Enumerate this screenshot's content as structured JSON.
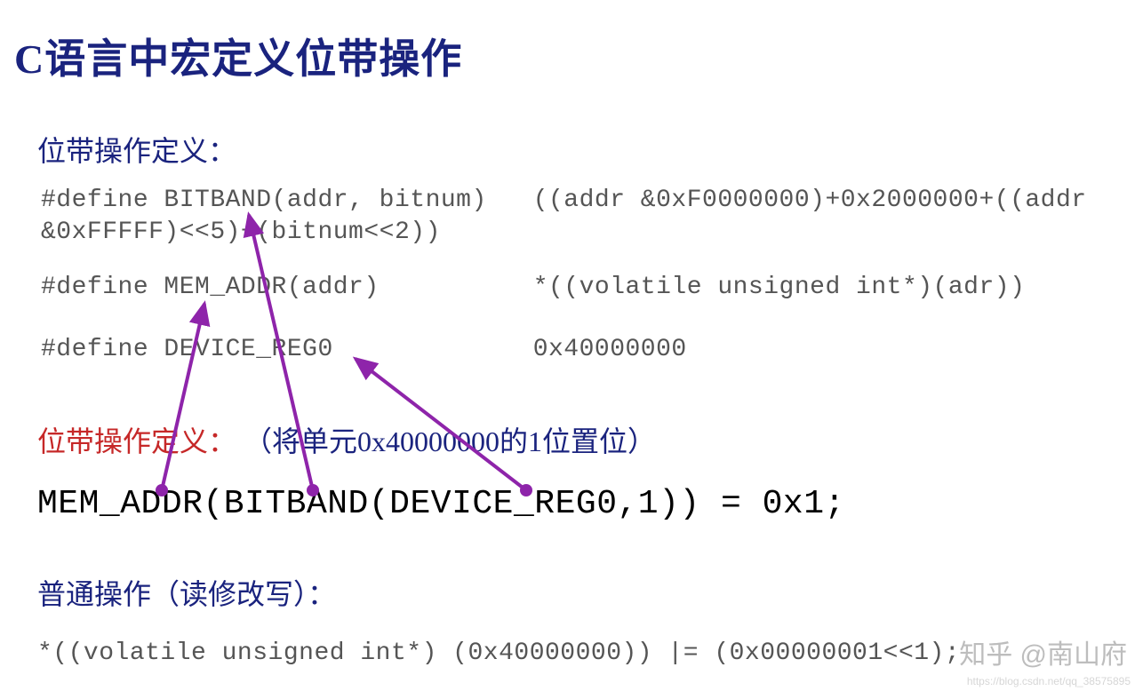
{
  "title": "C语言中宏定义位带操作",
  "section1_heading": "位带操作定义：",
  "define1": "#define BITBAND(addr, bitnum)   ((addr &0xF0000000)+0x2000000+((addr\n&0xFFFFF)<<5)+(bitnum<<2))",
  "define2": "#define MEM_ADDR(addr)          *((volatile unsigned int*)(adr))",
  "define3": "#define DEVICE_REG0             0x40000000",
  "section2_heading_red": "位带操作定义：",
  "section2_heading_blue": "（将单元0x40000000的1位置位）",
  "usage_line": "MEM_ADDR(BITBAND(DEVICE_REG0,1)) = 0x1;",
  "section3_heading": "普通操作（读修改写）：",
  "final_code": "*((volatile unsigned int*) (0x40000000)) |= (0x00000001<<1);",
  "watermark_main": "知乎 @南山府",
  "watermark_url": "https://blog.csdn.net/qq_38575895"
}
